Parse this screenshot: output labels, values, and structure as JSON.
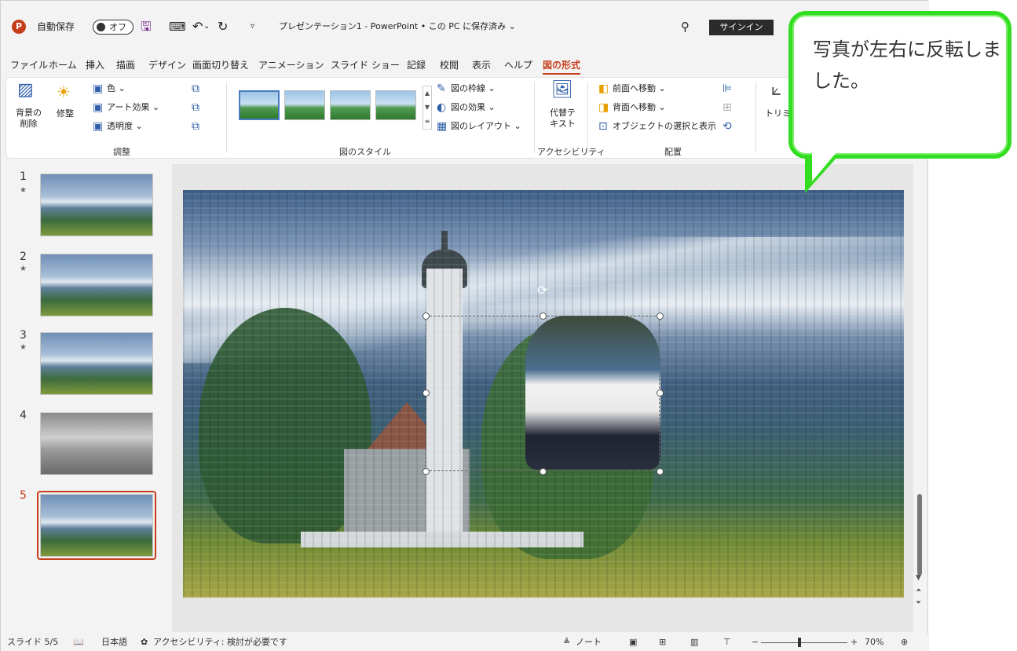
{
  "titlebar": {
    "app_icon": "P",
    "autosave_label": "自動保存",
    "autosave_state": "オフ",
    "save_icon": "save-icon",
    "document_title": "プレゼンテーション1 - PowerPoint • この PC に保存済み ⌄",
    "search_icon": "search-icon",
    "signin_label": "サインイン"
  },
  "menu_tabs": [
    "ファイル",
    "ホーム",
    "挿入",
    "描画",
    "デザイン",
    "画面切り替え",
    "アニメーション",
    "スライド ショー",
    "記録",
    "校閲",
    "表示",
    "ヘルプ",
    "図の形式"
  ],
  "active_tab": "図の形式",
  "ribbon": {
    "adjust": {
      "remove_bg": "背景の\n削除",
      "corrections": "修整",
      "color": "色 ⌄",
      "artistic": "アート効果 ⌄",
      "transparency": "透明度 ⌄",
      "group_label": "調整"
    },
    "styles": {
      "border": "図の枠線 ⌄",
      "effects": "図の効果 ⌄",
      "layout": "図のレイアウト ⌄",
      "group_label": "図のスタイル"
    },
    "accessibility": {
      "alt_text": "代替テ\nキスト",
      "group_label": "アクセシビリティ"
    },
    "arrange": {
      "bring_forward": "前面へ移動 ⌄",
      "send_backward": "背面へ移動 ⌄",
      "selection_pane": "オブジェクトの選択と表示",
      "group_label": "配置"
    },
    "crop": "トリミング"
  },
  "slides": [
    {
      "num": "1",
      "star": "★"
    },
    {
      "num": "2",
      "star": "★"
    },
    {
      "num": "3",
      "star": "★"
    },
    {
      "num": "4",
      "star": ""
    },
    {
      "num": "5",
      "star": ""
    }
  ],
  "active_slide": 5,
  "statusbar": {
    "slide_info": "スライド 5/5",
    "language": "日本語",
    "accessibility": "アクセシビリティ: 検討が必要です",
    "notes": "ノート",
    "zoom": "70%"
  },
  "callout": {
    "text": "写真が左右に反転しました。"
  },
  "colors": {
    "accent": "#c43e1c",
    "callout_border": "#33dd22"
  }
}
